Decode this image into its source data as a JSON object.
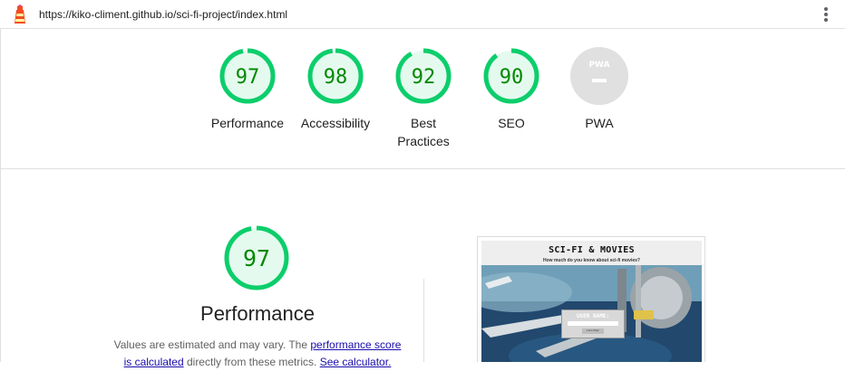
{
  "topbar": {
    "url": "https://kiko-climent.github.io/sci-fi-project/index.html"
  },
  "colors": {
    "pass": "#0cce6b",
    "pass_text": "#008800",
    "pass_bg": "#e5faef",
    "na": "#9e9e9e",
    "na_bg": "#e0e0e0"
  },
  "categories": [
    {
      "label": "Performance",
      "score": "97",
      "fraction": 0.97
    },
    {
      "label": "Accessibility",
      "score": "98",
      "fraction": 0.98
    },
    {
      "label": "Best\nPractices",
      "score": "92",
      "fraction": 0.92
    },
    {
      "label": "SEO",
      "score": "90",
      "fraction": 0.9
    },
    {
      "label": "PWA",
      "score": "",
      "fraction": 0
    }
  ],
  "performance": {
    "score": "97",
    "fraction": 0.97,
    "title": "Performance",
    "desc_prefix": "Values are estimated and may vary. The ",
    "link1": "performance score",
    "link2": "is calculated",
    "desc_mid": " directly from these metrics. ",
    "link3": "See calculator."
  },
  "pwa_badge": "PWA",
  "screenshot": {
    "title": "SCI-FI & MOVIES",
    "subtitle": "How much do you know about sci-fi movies?",
    "form_label": "USER NAME:",
    "button": "Let's Play!"
  }
}
